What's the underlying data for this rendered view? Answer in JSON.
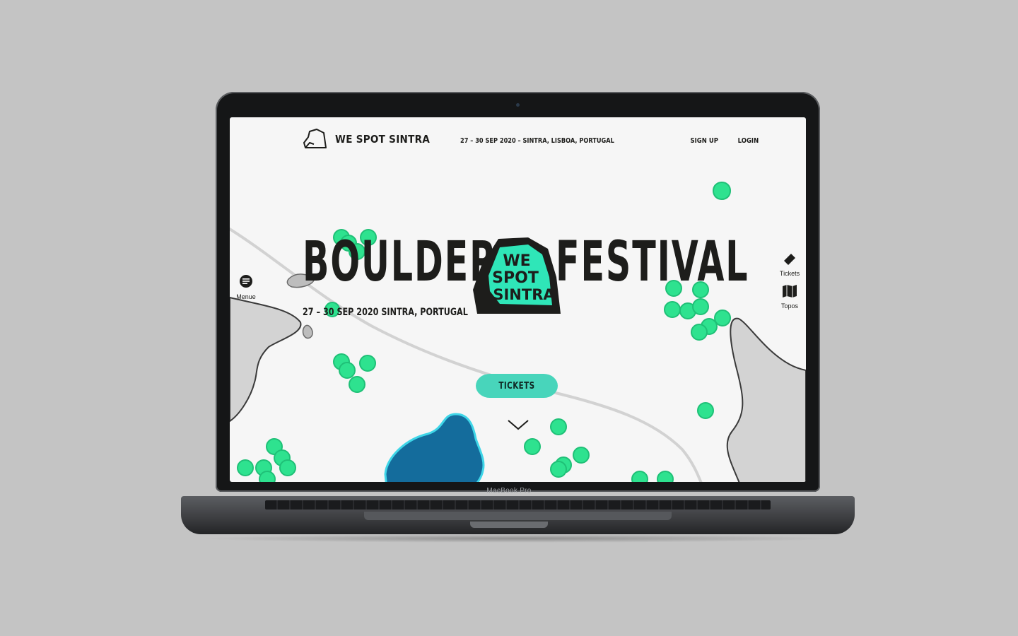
{
  "device": {
    "brand_label": "MacBook Pro"
  },
  "header": {
    "logo_text": "WE SPOT SINTRA",
    "event_info": "27 – 30 SEP 2020 – SINTRA, LISBOA, PORTUGAL",
    "nav": [
      {
        "label": "SIGN UP"
      },
      {
        "label": "LOGIN"
      }
    ]
  },
  "hero": {
    "title_left": "BOULDER",
    "title_right": "FESTIVAL",
    "badge_lines": [
      "WE",
      "SPOT",
      "SINTRA"
    ],
    "subtitle": "27 – 30 SEP 2020 SINTRA, PORTUGAL"
  },
  "side_menu": {
    "label": "Menue",
    "icon": "menu-lines-icon"
  },
  "side_actions": [
    {
      "label": "Tickets",
      "icon": "ticket-icon"
    },
    {
      "label": "Topos",
      "icon": "map-icon"
    }
  ],
  "cta": {
    "label": "TICKETS"
  },
  "colors": {
    "tree": "#2ee28f",
    "lake": "#146c9c",
    "lake_outline": "#3fd6e8",
    "rock": "#d3d3d3",
    "accent": "#48d5bb",
    "ink": "#1d1d1b"
  }
}
